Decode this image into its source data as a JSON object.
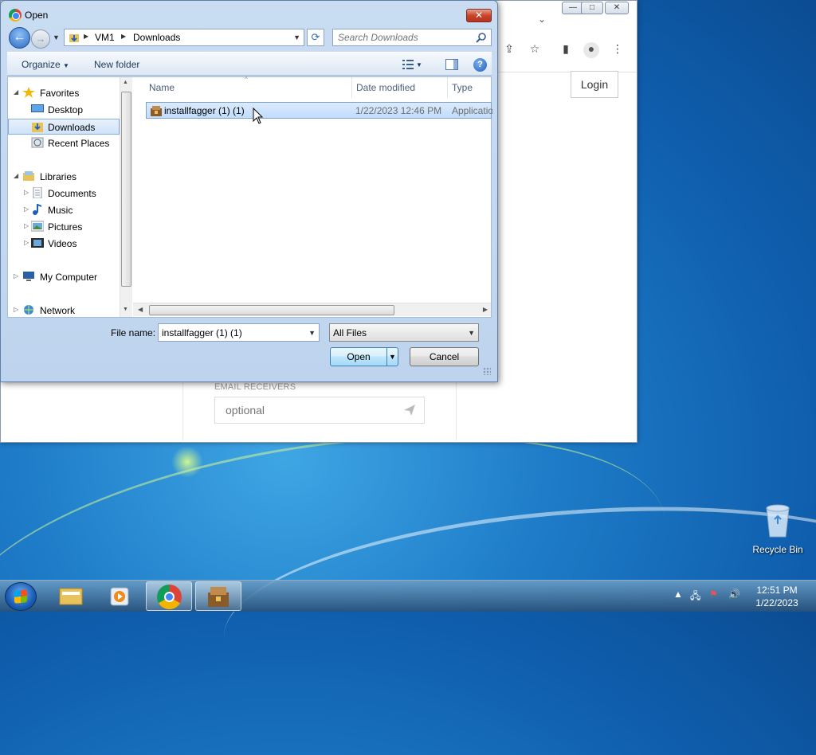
{
  "dialog": {
    "title": "Open",
    "close_label": "✕",
    "breadcrumb": [
      "VM1",
      "Downloads"
    ],
    "search_placeholder": "Search Downloads",
    "toolbar": {
      "organize": "Organize",
      "new_folder": "New folder",
      "help": "?"
    },
    "nav": {
      "favorites": "Favorites",
      "desktop": "Desktop",
      "downloads": "Downloads",
      "recent_places": "Recent Places",
      "libraries": "Libraries",
      "documents": "Documents",
      "music": "Music",
      "pictures": "Pictures",
      "videos": "Videos",
      "my_computer": "My Computer",
      "network": "Network"
    },
    "columns": {
      "name": "Name",
      "date": "Date modified",
      "type": "Type"
    },
    "files": [
      {
        "name": "installfagger (1) (1)",
        "date": "1/22/2023 12:46 PM",
        "type": "Application"
      }
    ],
    "file_name_label": "File name:",
    "file_name_value": "installfagger (1) (1)",
    "file_type": "All Files",
    "open_button": "Open",
    "cancel_button": "Cancel"
  },
  "browser": {
    "login_button": "Login",
    "email_label": "EMAIL RECEIVERS",
    "email_placeholder": "optional"
  },
  "desktop": {
    "recycle_bin": "Recycle Bin"
  },
  "taskbar": {
    "time": "12:51 PM",
    "date": "1/22/2023"
  }
}
